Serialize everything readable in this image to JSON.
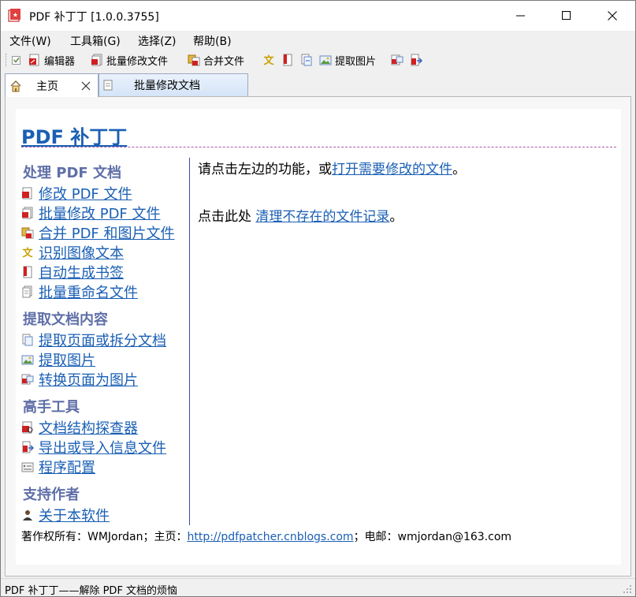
{
  "window": {
    "title": "PDF 补丁丁 [1.0.0.3755]"
  },
  "menu": [
    "文件(W)",
    "工具箱(G)",
    "选择(Z)",
    "帮助(B)"
  ],
  "toolbar": {
    "editor": "编辑器",
    "batch_modify": "批量修改文件",
    "merge": "合并文件",
    "extract_images": "提取图片"
  },
  "tabs": {
    "home": "主页",
    "batch": "批量修改文档"
  },
  "page": {
    "title": "PDF 补丁丁",
    "sections": [
      {
        "heading": "处理 PDF 文档",
        "links": [
          "修改 PDF 文件",
          "批量修改 PDF 文件",
          "合并 PDF 和图片文件",
          "识别图像文本",
          "自动生成书签",
          "批量重命名文件"
        ]
      },
      {
        "heading": "提取文档内容",
        "links": [
          "提取页面或拆分文档",
          "提取图片",
          "转换页面为图片"
        ]
      },
      {
        "heading": "高手工具",
        "links": [
          "文档结构探查器",
          "导出或导入信息文件",
          "程序配置"
        ]
      },
      {
        "heading": "支持作者",
        "links": [
          "关于本软件"
        ]
      }
    ],
    "right": {
      "line1_prefix": "请点击左边的功能，或",
      "line1_link": "打开需要修改的文件",
      "line1_suffix": "。",
      "line2_prefix": "点击此处 ",
      "line2_link": "清理不存在的文件记录",
      "line2_suffix": "。"
    },
    "footer": {
      "copyright": "著作权所有：WMJordan；主页：",
      "homepage": "http://pdfpatcher.cnblogs.com",
      "email_label": "；电邮：wmjordan@163.com"
    }
  },
  "status": "PDF 补丁丁——解除 PDF 文档的烦恼",
  "colors": {
    "link": "#1a5fb4",
    "section_heading": "#5f6fa8",
    "title_rule": "#b05aa5"
  }
}
